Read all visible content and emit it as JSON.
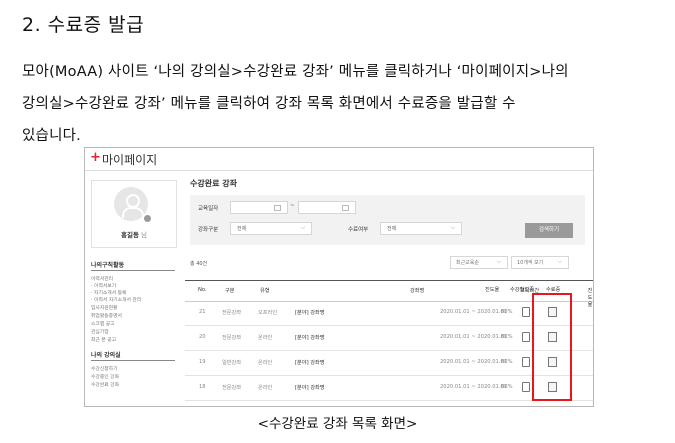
{
  "heading": "2. 수료증 발급",
  "paragraph": {
    "line1": "모아(MoAA) 사이트 ‘나의 강의실>수강완료 강좌’ 메뉴를 클릭하거나 ‘마이페이지>나의",
    "line2": "강의실>수강완료 강좌’ 메뉴를 클릭하여 강좌 목록 화면에서 수료증을 발급할 수",
    "line3": "있습니다."
  },
  "caption": "<수강완료 강좌 목록 화면>",
  "accent_color": "#e8171d",
  "screenshot": {
    "mypage_title": "마이페이지",
    "user_name": "홍길동",
    "user_suffix": "님",
    "sidebar": {
      "section1_title": "나의구직활동",
      "section1_items": [
        "이력서관리",
        "· 이력서보기",
        "· 자기소개서 등록",
        "· 이력서 자기소개서 관리",
        "입사지원현황",
        "취업활동증명서",
        "스크랩 공고",
        "관심기업",
        "최근 본 공고"
      ],
      "section2_title": "나의 강의실",
      "section2_items": [
        "수강신청하기",
        "수강중인 강좌",
        "수강완료 강좌"
      ]
    },
    "main_title": "수강완료 강좌",
    "filter": {
      "period_label": "교육일자",
      "period_sep": "~",
      "type_label": "강좌구분",
      "type_value": "전체",
      "complete_label": "수료여부",
      "complete_value": "전체",
      "search_button": "검색하기"
    },
    "total": "총 40건",
    "sort_select": "최근교육순",
    "per_page_select": "10개씩 보기",
    "columns": [
      "No.",
      "구분",
      "유형",
      "강좌명",
      "교육기간",
      "진도율",
      "수강확인증",
      "수료증"
    ],
    "rows": [
      {
        "no": "21",
        "category": "전문강좌",
        "type": "오프라인",
        "title": "[분야] 강좌명",
        "period": "2020.01.01 ~ 2020.01.01",
        "progress": "80%"
      },
      {
        "no": "20",
        "category": "전문강좌",
        "type": "온라인",
        "title": "[분야] 강좌명",
        "period": "2020.01.01 ~ 2020.01.01",
        "progress": "80%"
      },
      {
        "no": "19",
        "category": "일반강좌",
        "type": "온라인",
        "title": "[분야] 강좌명",
        "period": "2020.01.01 ~ 2020.01.01",
        "progress": "80%"
      },
      {
        "no": "18",
        "category": "전문강좌",
        "type": "온라인",
        "title": "[분야] 강좌명",
        "period": "2020.01.01 ~ 2020.01.01",
        "progress": "80%"
      }
    ]
  }
}
